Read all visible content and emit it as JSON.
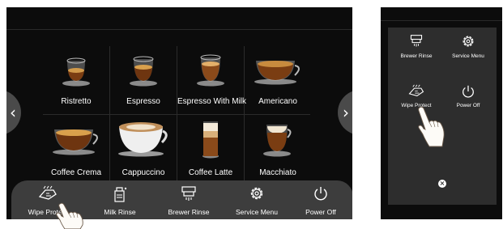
{
  "main_screen": {
    "nav_left_glyph": "‹",
    "nav_right_glyph": "›",
    "drinks": [
      {
        "label": "Ristretto",
        "icon": "ristretto-cup-icon"
      },
      {
        "label": "Espresso",
        "icon": "espresso-cup-icon"
      },
      {
        "label": "Espresso With Milk",
        "icon": "espresso-with-milk-cup-icon"
      },
      {
        "label": "Americano",
        "icon": "americano-cup-icon"
      },
      {
        "label": "Coffee Crema",
        "icon": "coffee-crema-cup-icon"
      },
      {
        "label": "Cappuccino",
        "icon": "cappuccino-cup-icon"
      },
      {
        "label": "Coffee Latte",
        "icon": "coffee-latte-glass-icon"
      },
      {
        "label": "Macchiato",
        "icon": "macchiato-glass-icon"
      }
    ],
    "bottom_menu": [
      {
        "label": "Wipe Protect",
        "icon": "wipe-protect-icon"
      },
      {
        "label": "Milk Rinse",
        "icon": "milk-rinse-icon"
      },
      {
        "label": "Brewer Rinse",
        "icon": "brewer-rinse-icon"
      },
      {
        "label": "Service Menu",
        "icon": "gear-icon"
      },
      {
        "label": "Power Off",
        "icon": "power-icon"
      }
    ]
  },
  "side_screen": {
    "menu": [
      {
        "label": "Brewer Rinse",
        "icon": "brewer-rinse-icon"
      },
      {
        "label": "Service Menu",
        "icon": "gear-icon"
      },
      {
        "label": "Wipe Protect",
        "icon": "wipe-protect-icon"
      },
      {
        "label": "Power Off",
        "icon": "power-icon"
      }
    ],
    "close_glyph": "×"
  },
  "colors": {
    "screen_bg": "#0c0c0c",
    "bottom_bar_bg": "#3d3d3d",
    "side_panel_bg": "#2d2d2d",
    "text": "#ffffff"
  }
}
